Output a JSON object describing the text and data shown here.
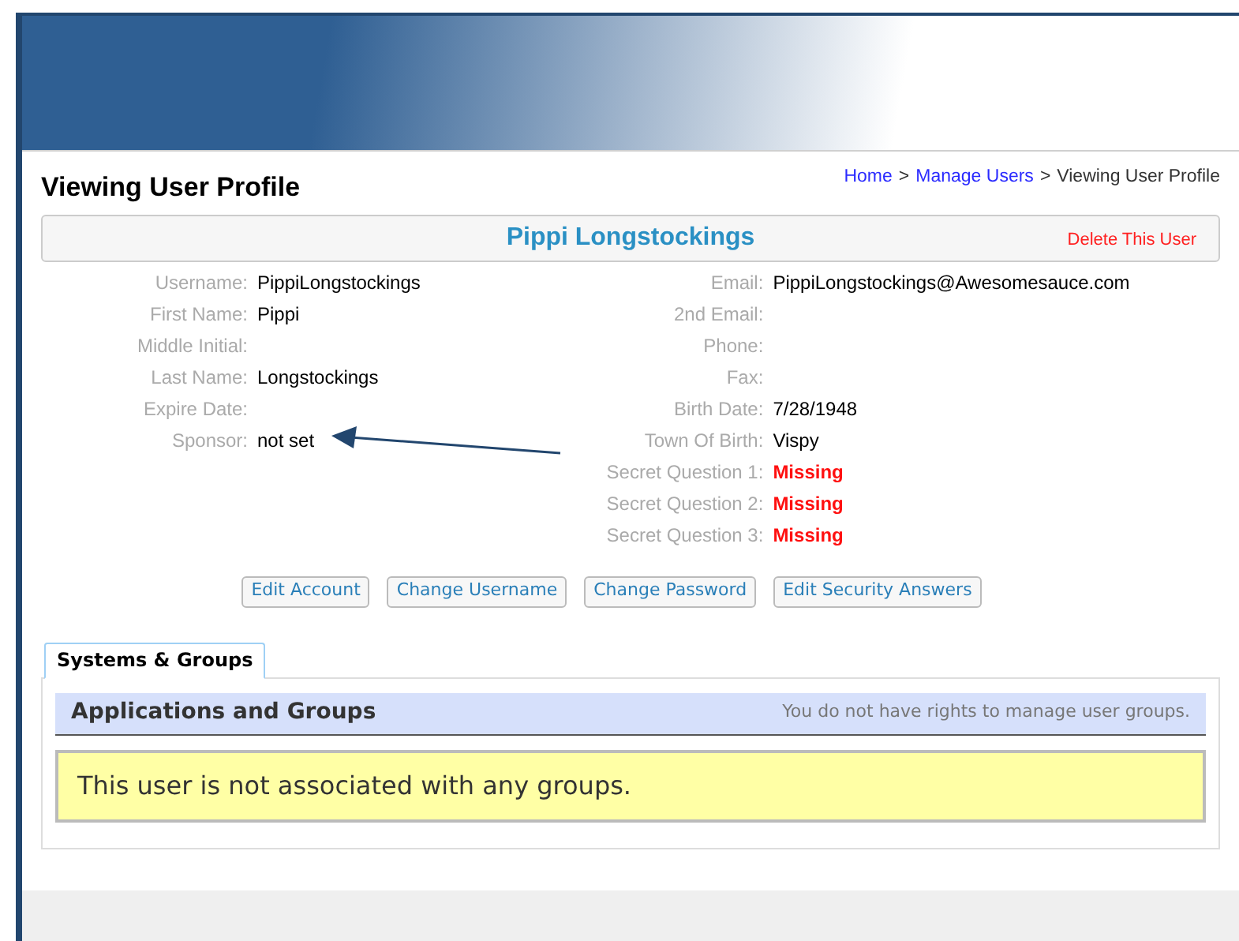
{
  "page_title": "Viewing User Profile",
  "breadcrumb": [
    {
      "label": "Home",
      "kind": "link"
    },
    {
      "label": ">",
      "kind": "separator"
    },
    {
      "label": "Manage Users",
      "kind": "link"
    },
    {
      "label": ">",
      "kind": "separator"
    },
    {
      "label": "Viewing User Profile",
      "kind": "current"
    }
  ],
  "profile_name": "Pippi Longstockings",
  "delete_link": "Delete This User",
  "left_fields": [
    {
      "label": "Username:",
      "value": "PippiLongstockings",
      "kind": "normal"
    },
    {
      "label": "First Name:",
      "value": "Pippi",
      "kind": "normal"
    },
    {
      "label": "Middle Initial:"
    },
    {
      "label": "Last Name:",
      "value": "Longstockings",
      "kind": "normal"
    },
    {
      "label": "Expire Date:"
    },
    {
      "label": "Sponsor:",
      "value": "not set",
      "kind": "normal"
    }
  ],
  "right_fields": [
    {
      "label": "Email:",
      "value": "PippiLongstockings@Awesomesauce.com",
      "kind": "normal"
    },
    {
      "label": "2nd Email:"
    },
    {
      "label": "Phone:"
    },
    {
      "label": "Fax:"
    },
    {
      "label": "Birth Date:",
      "value": "7/28/1948",
      "kind": "normal"
    },
    {
      "label": "Town Of Birth:",
      "value": "Vispy",
      "kind": "normal"
    },
    {
      "label": "Secret Question 1:",
      "value": "Missing",
      "kind": "missing"
    },
    {
      "label": "Secret Question 2:",
      "value": "Missing",
      "kind": "missing"
    },
    {
      "label": "Secret Question 3:",
      "value": "Missing",
      "kind": "missing"
    }
  ],
  "buttons": [
    "Edit Account",
    "Change Username",
    "Change Password",
    "Edit Security Answers"
  ],
  "tabs": [
    {
      "label": "Systems & Groups",
      "selected": true
    }
  ],
  "section": {
    "title": "Applications and Groups",
    "note": "You do not have rights to manage user groups.",
    "message": "This user is not associated with any groups."
  }
}
